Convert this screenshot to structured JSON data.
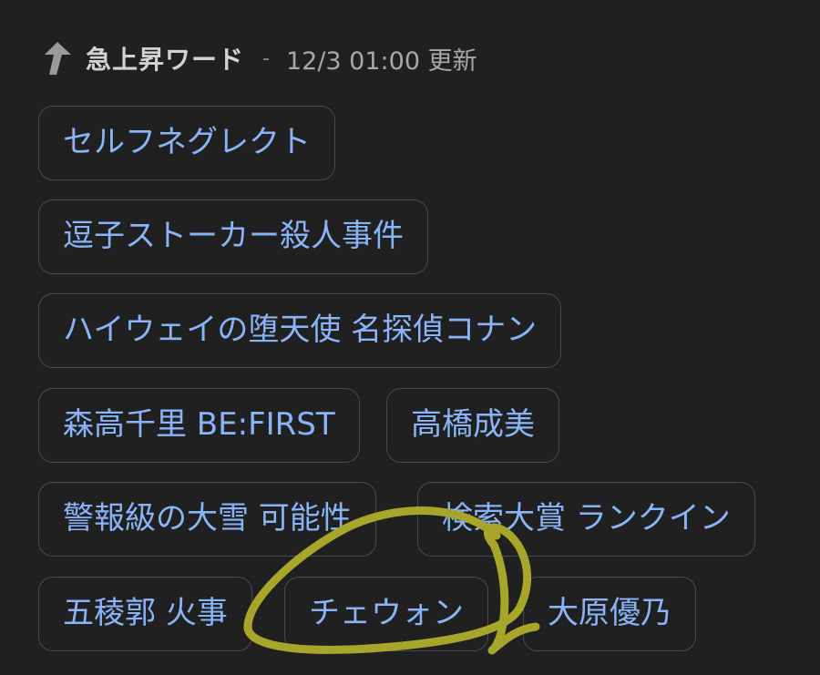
{
  "header": {
    "title": "急上昇ワード",
    "separator": "-",
    "updated": "12/3 01:00 更新",
    "icon": "trending-up-arrow-icon"
  },
  "keywords": [
    "セルフネグレクト",
    "逗子ストーカー殺人事件",
    "ハイウェイの堕天使 名探偵コナン",
    "森高千里 BE:FIRST",
    "高橋成美",
    "警報級の大雪 可能性",
    "検索大賞 ランクイン",
    "五稜郭 火事",
    "チェウォン",
    "大原優乃"
  ],
  "colors": {
    "background": "#202020",
    "chip_text": "#8ab4f8",
    "chip_border": "#4a4a4a",
    "annotation_stroke": "#a8a62a"
  }
}
